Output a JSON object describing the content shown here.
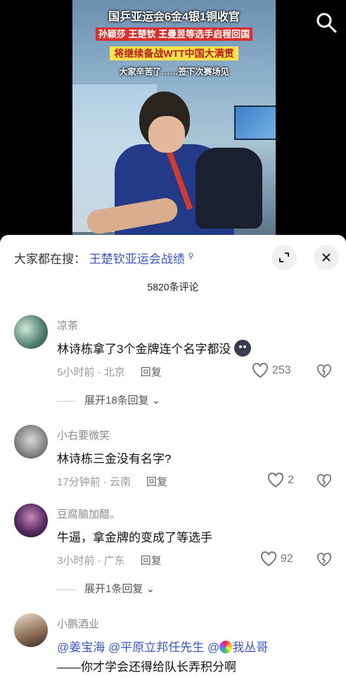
{
  "video": {
    "caption_line1": "国乒亚运会6金4银1铜收官",
    "caption_line2": "孙颖莎 王楚钦 王曼昱等选手启程回国",
    "caption_line3": "将继续备战WTT中国大满贯",
    "caption_line4": "大家辛苦了……签下次赛场见"
  },
  "search": {
    "label": "大家都在搜：",
    "query": "王楚钦亚运会战绩"
  },
  "comments_count": "5820条评论",
  "comments": [
    {
      "user": "凉茶",
      "text": "林诗栋拿了3个金牌连个名字都没",
      "time": "5小时前 · 北京",
      "reply": "回复",
      "likes": "253",
      "expand": "展开18条回复"
    },
    {
      "user": "小右要微笑",
      "text": "林诗栋三金没有名字?",
      "time": "17分钟前 · 云南",
      "reply": "回复",
      "likes": "2"
    },
    {
      "user": "豆腐脑加醋。",
      "text": "牛逼，拿金牌的变成了等选手",
      "time": "3小时前 · 广东",
      "reply": "回复",
      "likes": "92",
      "expand": "展开1条回复"
    },
    {
      "user": "小鹏酒业",
      "mention1": "@姜宝海",
      "mention2": "@平原立邦任先生",
      "mention3": "@",
      "mention3_name": "我丛哥",
      "text_line2": "——你才学会还得给队长弄积分啊"
    }
  ],
  "icons": {
    "search": "search-icon",
    "expand": "expand-icon",
    "close": "close-icon",
    "like": "heart-icon",
    "dislike": "broken-heart-icon"
  }
}
